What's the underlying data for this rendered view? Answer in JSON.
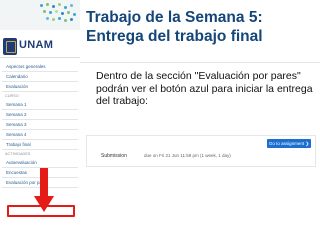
{
  "slide": {
    "title_line1": "Trabajo de la Semana 5:",
    "title_line2": "Entrega del trabajo final",
    "instruction": "Dentro de la sección \"Evaluación por pares\" podrán ver el botón azul para iniciar la entrega del trabajo:"
  },
  "screenshot": {
    "logo": {
      "name": "UNAM"
    },
    "sidebar": {
      "items_top": [
        "Aspectos generales",
        "Calendario",
        "Evaluación"
      ],
      "section_curso": "CURSO",
      "weeks": [
        "Semana 1",
        "Semana 2",
        "Semana 3",
        "Semana 4",
        "Trabajo final"
      ],
      "section_actividades": "ACTIVIDADES",
      "activities": [
        "Autoevaluación",
        "Encuestas",
        "Evaluación por pares"
      ]
    },
    "submission": {
      "label": "Submission",
      "due": "due on Fri 21 Jun 11:59 pm (1 week, 1 day)",
      "button_label": "Go to assignment ❯"
    }
  },
  "colors": {
    "title": "#14467a",
    "arrow": "#e41b17",
    "button": "#1c6fd0"
  }
}
